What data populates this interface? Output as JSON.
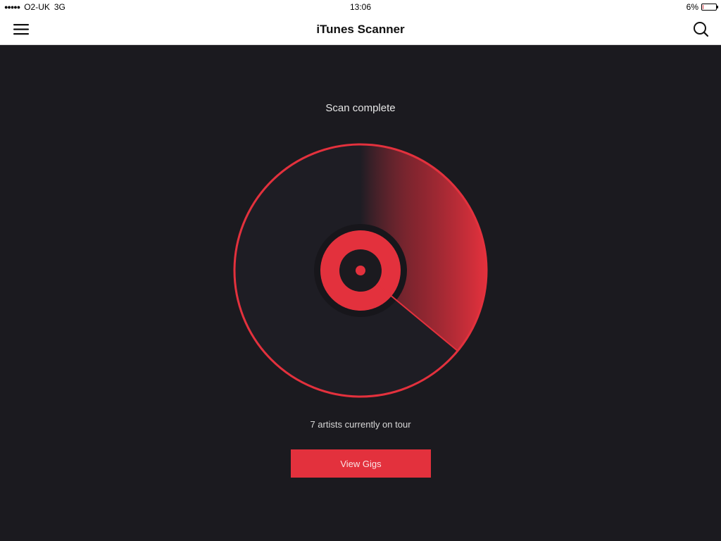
{
  "status_bar": {
    "signal_dots": "●●●●●",
    "carrier": "O2-UK",
    "network": "3G",
    "time": "13:06",
    "battery_percent": "6%",
    "battery_level": 0.06
  },
  "nav": {
    "title": "iTunes Scanner",
    "menu_icon": "hamburger-menu-icon",
    "search_icon": "search-icon"
  },
  "scan": {
    "title": "Scan complete",
    "progress": 0.36,
    "result_text": "7 artists currently on tour",
    "button_label": "View Gigs"
  },
  "colors": {
    "accent": "#e3313d",
    "background": "#1b1a1f",
    "disc_body": "#1e1d24"
  }
}
